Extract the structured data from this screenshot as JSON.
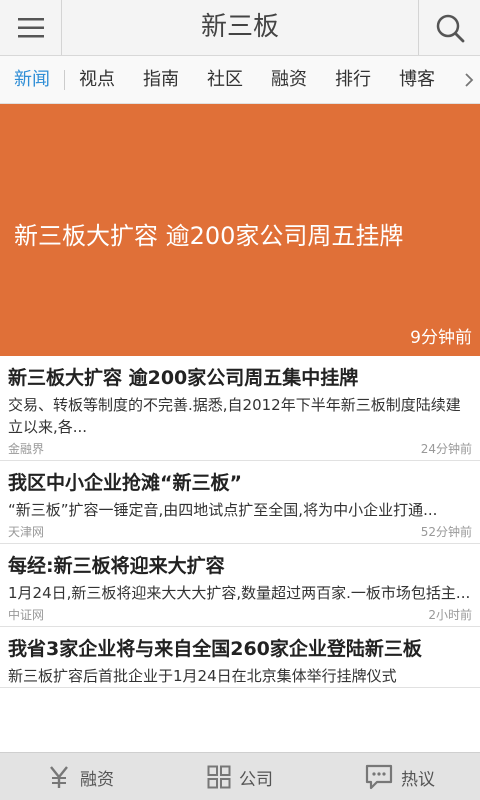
{
  "header": {
    "title": "新三板",
    "menu_icon": "hamburger-icon",
    "search_icon": "search-icon"
  },
  "tabs": [
    {
      "label": "新闻",
      "active": true
    },
    {
      "label": "视点"
    },
    {
      "label": "指南"
    },
    {
      "label": "社区"
    },
    {
      "label": "融资"
    },
    {
      "label": "排行"
    },
    {
      "label": "博客"
    }
  ],
  "banner": {
    "headline": "新三板大扩容 逾200家公司周五挂牌",
    "time": "9分钟前"
  },
  "news": [
    {
      "title": "新三板大扩容 逾200家公司周五集中挂牌",
      "summary": "交易、转板等制度的不完善.据悉,自2012年下半年新三板制度陆续建立以来,各...",
      "source": "金融界",
      "time": "24分钟前"
    },
    {
      "title": "我区中小企业抢滩“新三板”",
      "summary": "“新三板”扩容一锤定音,由四地试点扩至全国,将为中小企业打通...",
      "source": "天津网",
      "time": "52分钟前"
    },
    {
      "title": "每经:新三板将迎来大扩容",
      "summary": "1月24日,新三板将迎来大大大扩容,数量超过两百家.一板市场包括主...",
      "source": "中证网",
      "time": "2小时前"
    },
    {
      "title": "我省3家企业将与来自全国260家企业登陆新三板",
      "summary": "新三板扩容后首批企业于1月24日在北京集体举行挂牌仪式",
      "source": "",
      "time": ""
    }
  ],
  "bottom_nav": [
    {
      "label": "融资",
      "icon": "yen-icon"
    },
    {
      "label": "公司",
      "icon": "grid-icon"
    },
    {
      "label": "热议",
      "icon": "chat-icon"
    }
  ],
  "colors": {
    "accent": "#2f8ed6",
    "banner": "#e07038"
  }
}
